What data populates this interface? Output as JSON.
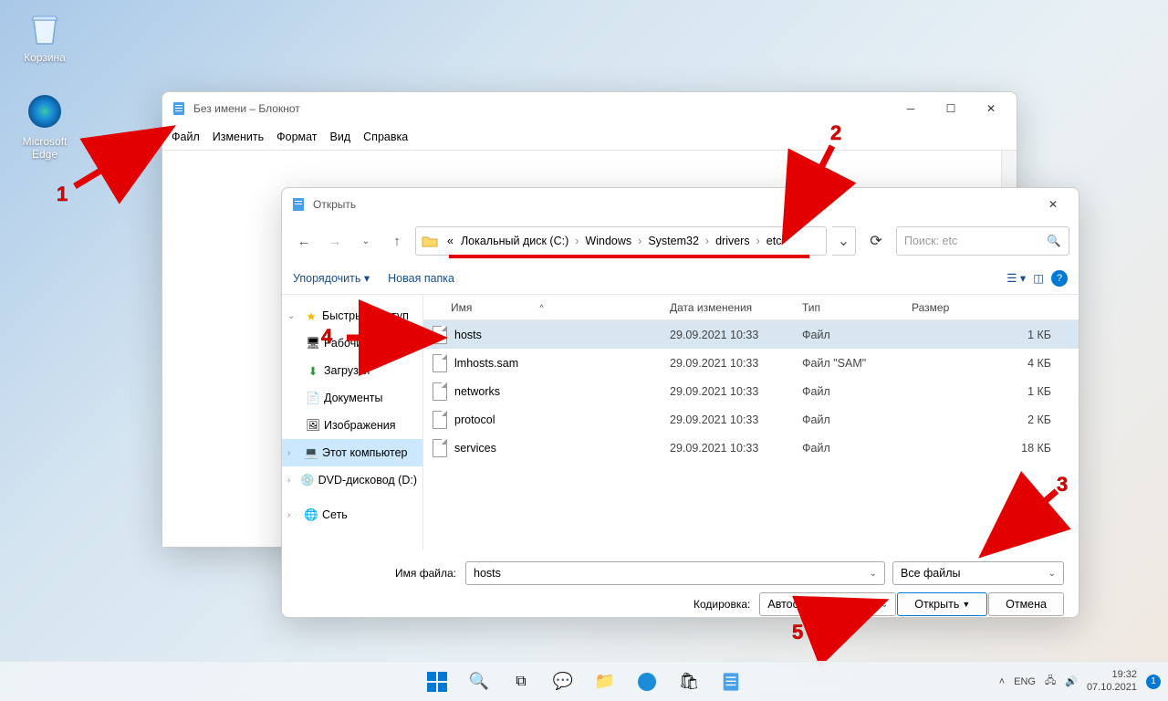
{
  "desktop": {
    "icons": [
      {
        "name": "Корзина"
      },
      {
        "name": "Microsoft Edge"
      }
    ]
  },
  "notepad": {
    "title": "Без имени – Блокнот",
    "menu": {
      "file": "Файл",
      "edit": "Изменить",
      "format": "Формат",
      "view": "Вид",
      "help": "Справка"
    }
  },
  "open_dialog": {
    "title": "Открыть",
    "breadcrumb": {
      "prefix": "«",
      "parts": [
        "Локальный диск (C:)",
        "Windows",
        "System32",
        "drivers",
        "etc"
      ]
    },
    "search_placeholder": "Поиск: etc",
    "organize": "Упорядочить",
    "new_folder": "Новая папка",
    "columns": {
      "name": "Имя",
      "modified": "Дата изменения",
      "type": "Тип",
      "size": "Размер"
    },
    "tree": {
      "quick": "Быстрый доступ",
      "desktop": "Рабочий стол",
      "downloads": "Загрузки",
      "documents": "Документы",
      "pictures": "Изображения",
      "this_pc": "Этот компьютер",
      "dvd": "DVD-дисковод (D:)",
      "network": "Сеть"
    },
    "files": [
      {
        "name": "hosts",
        "date": "29.09.2021 10:33",
        "type": "Файл",
        "size": "1 КБ",
        "selected": true
      },
      {
        "name": "lmhosts.sam",
        "date": "29.09.2021 10:33",
        "type": "Файл \"SAM\"",
        "size": "4 КБ"
      },
      {
        "name": "networks",
        "date": "29.09.2021 10:33",
        "type": "Файл",
        "size": "1 КБ"
      },
      {
        "name": "protocol",
        "date": "29.09.2021 10:33",
        "type": "Файл",
        "size": "2 КБ"
      },
      {
        "name": "services",
        "date": "29.09.2021 10:33",
        "type": "Файл",
        "size": "18 КБ"
      }
    ],
    "filename_label": "Имя файла:",
    "filename_value": "hosts",
    "encoding_label": "Кодировка:",
    "encoding_value": "Автообнаружение",
    "filter_value": "Все файлы",
    "open_btn": "Открыть",
    "cancel_btn": "Отмена"
  },
  "taskbar": {
    "lang": "ENG",
    "time": "19:32",
    "date": "07.10.2021"
  },
  "annotations": {
    "n1": "1",
    "n2": "2",
    "n3": "3",
    "n4": "4",
    "n5": "5"
  }
}
